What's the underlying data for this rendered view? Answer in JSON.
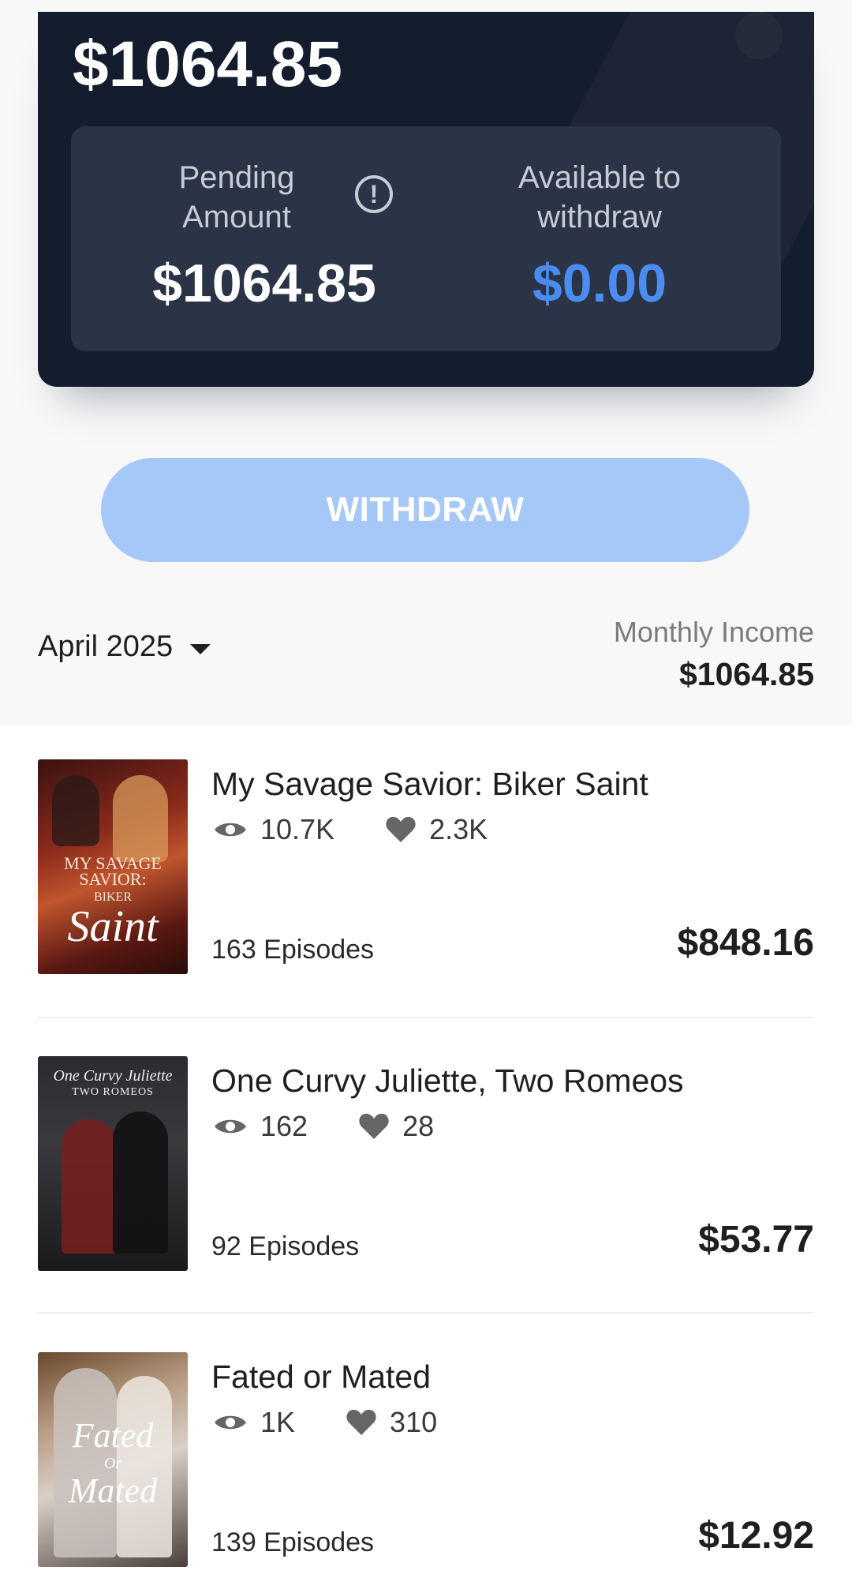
{
  "balance": {
    "total": "$1064.85",
    "pending_label": "Pending Amount",
    "pending_value": "$1064.85",
    "available_label": "Available to withdraw",
    "available_value": "$0.00"
  },
  "withdraw_button": "WITHDRAW",
  "period": {
    "month": "April 2025",
    "monthly_income_label": "Monthly Income",
    "monthly_income_value": "$1064.85"
  },
  "books": [
    {
      "title": "My Savage Savior: Biker Saint",
      "views": "10.7K",
      "likes": "2.3K",
      "episodes": "163 Episodes",
      "earnings": "$848.16",
      "cover_text": [
        "MY SAVAGE SAVIOR:",
        "BIKER",
        "Saint"
      ]
    },
    {
      "title": "One Curvy Juliette, Two Romeos",
      "views": "162",
      "likes": "28",
      "episodes": "92 Episodes",
      "earnings": "$53.77",
      "cover_text": [
        "One Curvy Juliette",
        "TWO ROMEOS"
      ]
    },
    {
      "title": "Fated or Mated",
      "views": "1K",
      "likes": "310",
      "episodes": "139 Episodes",
      "earnings": "$12.92",
      "cover_text": [
        "Fated",
        "Or",
        "Mated"
      ]
    }
  ],
  "colors": {
    "card_bg": "#141d2e",
    "inner_box_bg": "#2b3446",
    "accent_blue": "#4a8df2",
    "button_bg": "#a6c8f9"
  }
}
